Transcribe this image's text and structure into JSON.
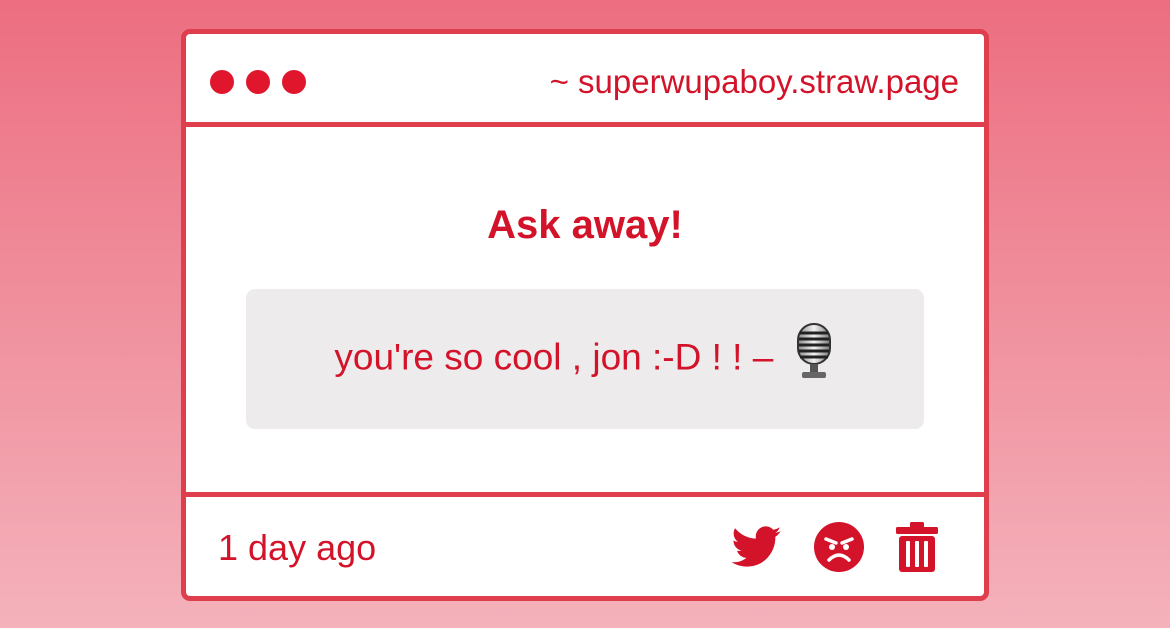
{
  "window": {
    "url": "~ superwupaboy.straw.page"
  },
  "main": {
    "heading": "Ask away!",
    "question": "you're so cool , jon :-D ! ! –",
    "question_emoji": "studio-microphone-icon"
  },
  "footer": {
    "time": "1 day ago",
    "actions": [
      "twitter-icon",
      "angry-face-icon",
      "trash-icon"
    ]
  },
  "colors": {
    "accent": "#d3132a",
    "border": "#df3e4d",
    "box": "#edebec"
  }
}
